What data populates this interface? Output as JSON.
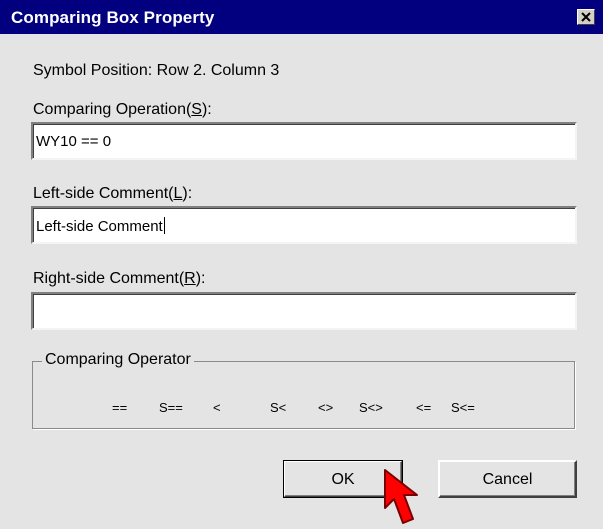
{
  "window": {
    "title": "Comparing Box Property",
    "close_icon": "close-icon"
  },
  "symbol_position": "Symbol Position:  Row 2. Column 3",
  "comparing_operation": {
    "label_prefix": "Comparing Operation(",
    "mnemonic": "S",
    "label_suffix": "):",
    "value": "WY10 == 0"
  },
  "left_comment": {
    "label_prefix": "Left-side Comment(",
    "mnemonic": "L",
    "label_suffix": "):",
    "value": "Left-side Comment"
  },
  "right_comment": {
    "label_prefix": "Right-side Comment(",
    "mnemonic": "R",
    "label_suffix": "):",
    "value": ""
  },
  "comparing_operator": {
    "legend": "Comparing Operator",
    "operators": [
      "==",
      "S==",
      "<",
      "S<",
      "<>",
      "S<>",
      "<=",
      "S<="
    ]
  },
  "buttons": {
    "ok": "OK",
    "cancel": "Cancel"
  },
  "cursor_icon": "arrow-pointer-icon",
  "colors": {
    "titlebar": "#03007f",
    "dialog_bg": "#e4e4e4",
    "cursor": "#ff0000"
  }
}
